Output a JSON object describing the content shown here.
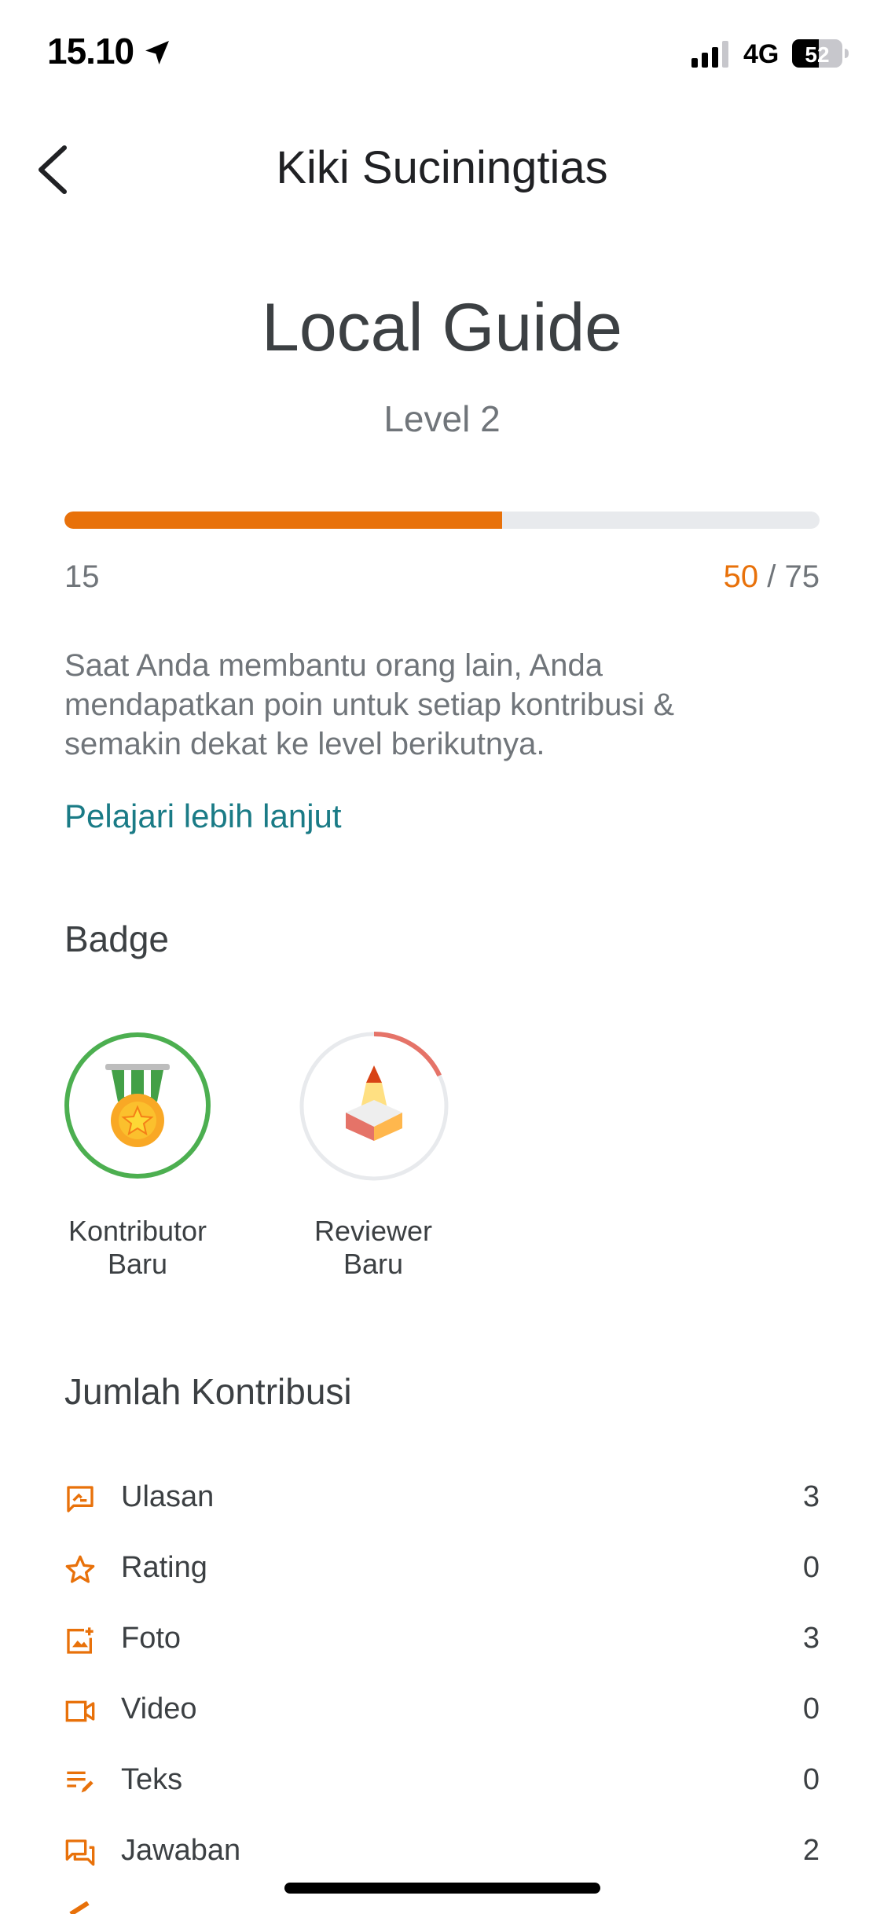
{
  "status_bar": {
    "time": "15.10",
    "network": "4G",
    "battery": "52"
  },
  "header": {
    "title": "Kiki Suciningtias"
  },
  "guide": {
    "title": "Local Guide",
    "level": "Level 2",
    "progress": {
      "start": "15",
      "current": "50",
      "separator": " / ",
      "goal": "75",
      "fill_fraction": 0.58
    },
    "description": "Saat Anda membantu orang lain, Anda mendapatkan poin untuk setiap kontribusi & semakin dekat ke level berikutnya.",
    "learn_more": "Pelajari lebih lanjut"
  },
  "badges": {
    "heading": "Badge",
    "items": [
      {
        "label_1": "Kontributor",
        "label_2": "Baru",
        "icon": "medal-icon"
      },
      {
        "label_1": "Reviewer",
        "label_2": "Baru",
        "icon": "cone-icon",
        "ring_fraction": 0.18
      }
    ]
  },
  "contributions": {
    "heading": "Jumlah Kontribusi",
    "items": [
      {
        "label": "Ulasan",
        "value": "3",
        "icon": "review-icon"
      },
      {
        "label": "Rating",
        "value": "0",
        "icon": "star-icon"
      },
      {
        "label": "Foto",
        "value": "3",
        "icon": "photo-icon"
      },
      {
        "label": "Video",
        "value": "0",
        "icon": "video-icon"
      },
      {
        "label": "Teks",
        "value": "0",
        "icon": "text-edit-icon"
      },
      {
        "label": "Jawaban",
        "value": "2",
        "icon": "answer-icon"
      }
    ]
  },
  "colors": {
    "accent": "#e8710a",
    "link": "#1a7b86",
    "badge_green": "#4caf50",
    "badge_red": "#e57368"
  }
}
